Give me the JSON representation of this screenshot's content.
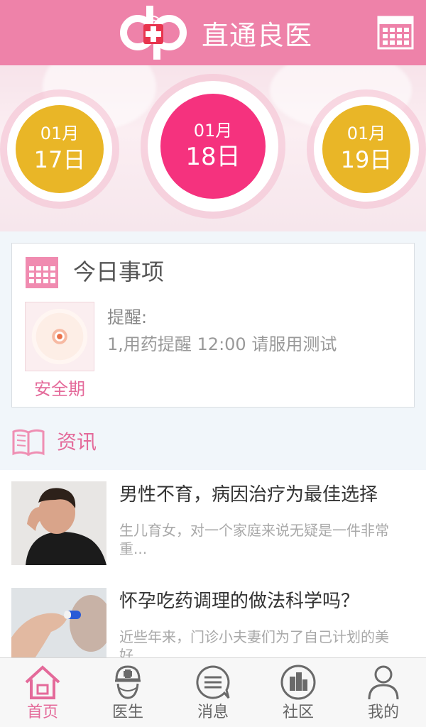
{
  "header": {
    "title": "直通良医",
    "logo_icon": "dp-medical-logo",
    "calendar_icon": "calendar-icon",
    "brand_color": "#ee82a9"
  },
  "dates": [
    {
      "month": "01月",
      "day": "17日",
      "color": "#e9b627"
    },
    {
      "month": "01月",
      "day": "18日",
      "color": "#f5327e",
      "selected": true
    },
    {
      "month": "01月",
      "day": "19日",
      "color": "#e9b627"
    }
  ],
  "today": {
    "title": "今日事项",
    "status_label": "安全期",
    "reminder_title": "提醒:",
    "reminder_text": "1,用药提醒 12:00 请服用测试"
  },
  "news": {
    "section_label": "资讯",
    "items": [
      {
        "title": "男性不育，病因治疗为最佳选择",
        "desc": "生儿育女，对一个家庭来说无疑是一件非常重..."
      },
      {
        "title": "怀孕吃药调理的做法科学吗？",
        "desc": "近些年来，门诊小夫妻们为了自己计划的美好..."
      }
    ]
  },
  "nav": {
    "items": [
      {
        "label": "首页",
        "icon": "home-icon",
        "active": true
      },
      {
        "label": "医生",
        "icon": "doctor-icon",
        "active": false
      },
      {
        "label": "消息",
        "icon": "message-icon",
        "active": false
      },
      {
        "label": "社区",
        "icon": "community-icon",
        "active": false
      },
      {
        "label": "我的",
        "icon": "profile-icon",
        "active": false
      }
    ],
    "active_color": "#e46a9a"
  }
}
